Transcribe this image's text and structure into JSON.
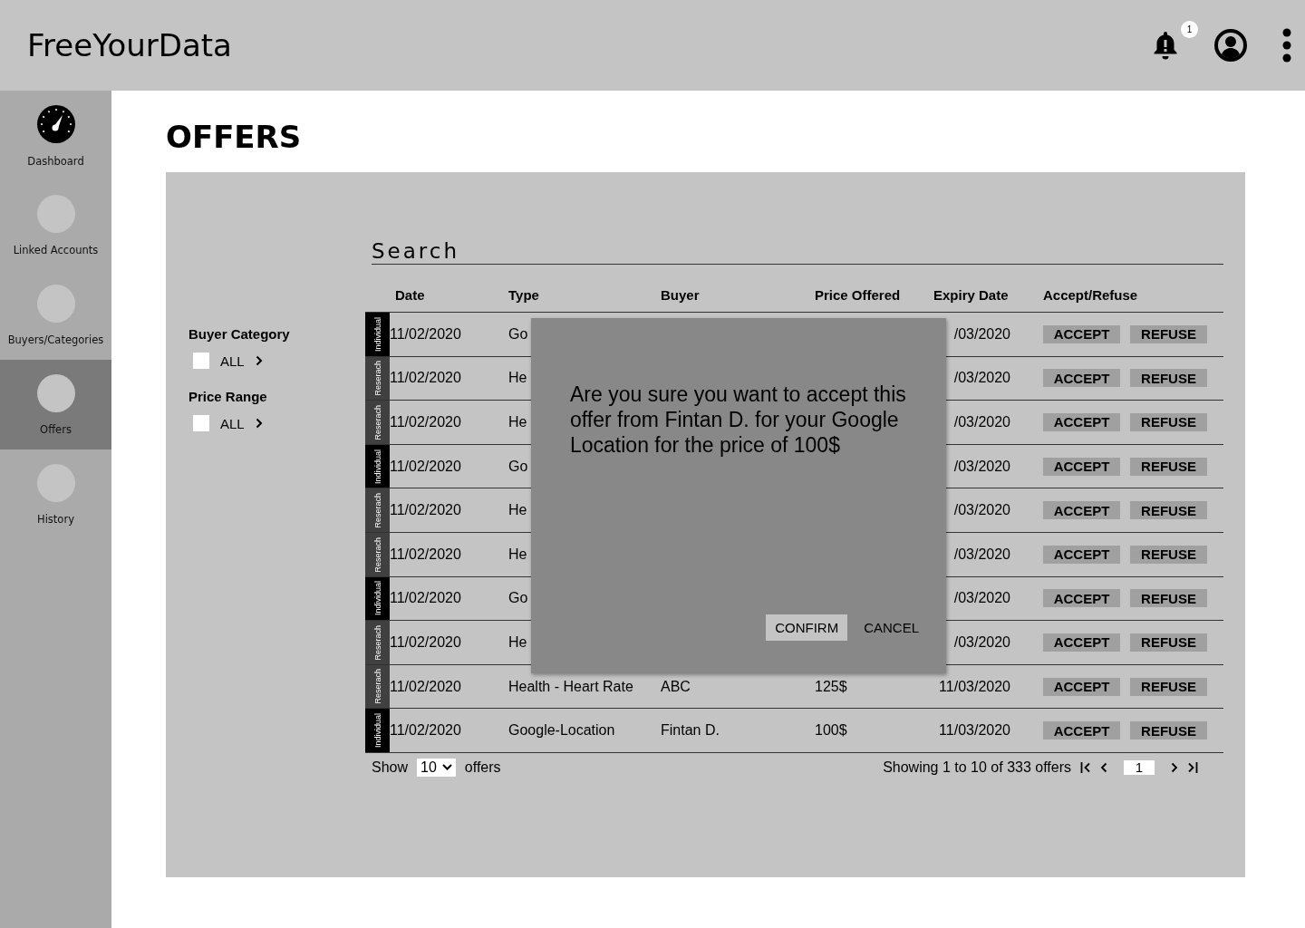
{
  "app_bar": {
    "title": "FreeYourData",
    "notification_count": "1"
  },
  "sidebar": {
    "items": [
      {
        "label": "Dashboard",
        "selected": false
      },
      {
        "label": "Linked Accounts",
        "selected": false
      },
      {
        "label": "Buyers/Categories",
        "selected": false
      },
      {
        "label": "Offers",
        "selected": true
      },
      {
        "label": "History",
        "selected": false
      }
    ]
  },
  "page_title": "OFFERS",
  "search": {
    "placeholder": "Search"
  },
  "filters": [
    {
      "title": "Buyer Category",
      "label": "ALL",
      "checked": false
    },
    {
      "title": "Price Range",
      "label": "ALL",
      "checked": false
    }
  ],
  "table": {
    "columns": [
      "Date",
      "Type",
      "Buyer",
      "Price Offered",
      "Expiry Date",
      "Accept/Refuse"
    ],
    "rows": [
      {
        "tag": {
          "kind": "individual",
          "label": "Individual"
        },
        "date": "11/02/2020",
        "type": "Go",
        "expiry": "/03/2020",
        "accept": "ACCEPT",
        "refuse": "REFUSE"
      },
      {
        "tag": {
          "kind": "research",
          "label": "Reserach"
        },
        "date": "11/02/2020",
        "type": "He",
        "expiry": "/03/2020",
        "accept": "ACCEPT",
        "refuse": "REFUSE"
      },
      {
        "tag": {
          "kind": "research",
          "label": "Reserach"
        },
        "date": "11/02/2020",
        "type": "He",
        "expiry": "/03/2020",
        "accept": "ACCEPT",
        "refuse": "REFUSE"
      },
      {
        "tag": {
          "kind": "individual",
          "label": "Individual"
        },
        "date": "11/02/2020",
        "type": "Go",
        "expiry": "/03/2020",
        "accept": "ACCEPT",
        "refuse": "REFUSE"
      },
      {
        "tag": {
          "kind": "research",
          "label": "Reserach"
        },
        "date": "11/02/2020",
        "type": "He",
        "expiry": "/03/2020",
        "accept": "ACCEPT",
        "refuse": "REFUSE"
      },
      {
        "tag": {
          "kind": "research",
          "label": "Reserach"
        },
        "date": "11/02/2020",
        "type": "He",
        "expiry": "/03/2020",
        "accept": "ACCEPT",
        "refuse": "REFUSE"
      },
      {
        "tag": {
          "kind": "individual",
          "label": "Individual"
        },
        "date": "11/02/2020",
        "type": "Go",
        "expiry": "/03/2020",
        "accept": "ACCEPT",
        "refuse": "REFUSE"
      },
      {
        "tag": {
          "kind": "research",
          "label": "Reserach"
        },
        "date": "11/02/2020",
        "type": "He",
        "expiry": "/03/2020",
        "accept": "ACCEPT",
        "refuse": "REFUSE"
      },
      {
        "tag": {
          "kind": "research",
          "label": "Reserach"
        },
        "date": "11/02/2020",
        "type": "Health - Heart Rate",
        "buyer": "ABC",
        "price": "125$",
        "expiry": "11/03/2020",
        "accept": "ACCEPT",
        "refuse": "REFUSE"
      },
      {
        "tag": {
          "kind": "individual",
          "label": "Individual"
        },
        "date": "11/02/2020",
        "type": "Google-Location",
        "buyer": "Fintan D.",
        "price": "100$",
        "expiry": "11/03/2020",
        "accept": "ACCEPT",
        "refuse": "REFUSE"
      }
    ]
  },
  "pagination": {
    "show_label": "Show",
    "page_size": "10",
    "offers_label": "offers",
    "summary": "Showing 1 to 10 of 333 offers",
    "page": "1"
  },
  "dialog": {
    "message": "Are you sure you want to accept this offer from Fintan D.  for your Google Location for the price of 100$",
    "confirm": "CONFIRM",
    "cancel": "CANCEL"
  }
}
